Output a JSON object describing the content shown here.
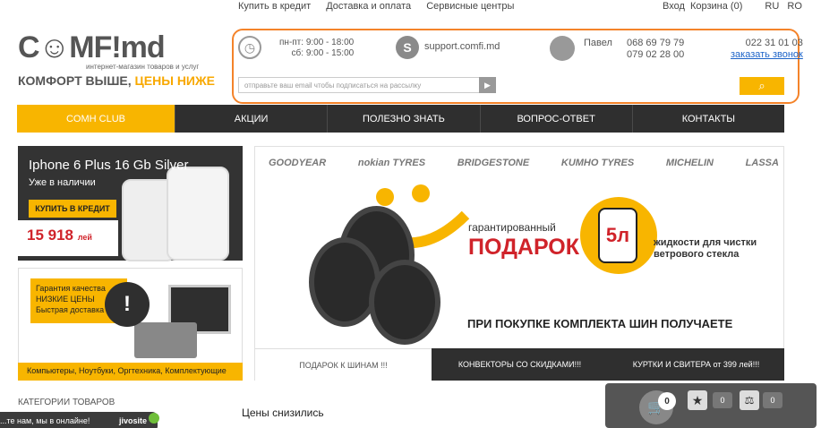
{
  "top_links": {
    "credit": "Купить в кредит",
    "delivery": "Доставка и оплата",
    "service": "Сервисные центры"
  },
  "top_right": {
    "login": "Вход",
    "cart": "Корзина (0)",
    "lang_ru": "RU",
    "lang_ro": "RO"
  },
  "logo": {
    "text": "C☺MF!md",
    "subtitle": "интернет-магазин товаров и услуг",
    "slogan_a": "КОМФОРТ ВЫШЕ,",
    "slogan_b": "ЦЕНЫ НИЖЕ"
  },
  "hours": {
    "weekdays": "пн-пт: 9:00 - 18:00",
    "saturday": "сб: 9:00 - 15:00"
  },
  "skype": {
    "label": "support.comfi.md"
  },
  "contact": {
    "name": "Павел",
    "phone1": "068 69 79 79",
    "phone2": "079 02 28 00",
    "phone3": "022 31 01 03",
    "callback": "заказать звонок"
  },
  "subscribe": {
    "placeholder": "отправьте ваш email чтобы подписаться на рассылку"
  },
  "nav": [
    "COMH CLUB",
    "АКЦИИ",
    "ПОЛЕЗНО ЗНАТЬ",
    "ВОПРОС-ОТВЕТ",
    "КОНТАКТЫ"
  ],
  "banner1": {
    "title": "Iphone 6 Plus 16 Gb Silver",
    "subtitle": "Уже в наличии",
    "button": "КУПИТЬ В КРЕДИТ",
    "price": "15 918",
    "currency": "лей"
  },
  "banner2": {
    "line1": "Гарантия качества",
    "line2": "НИЗКИЕ ЦЕНЫ",
    "line3": "Быстрая доставка",
    "footer": "Компьютеры, Ноутбуки, Оргтехника, Комплектующие",
    "mark": "!"
  },
  "brands": [
    "GOODYEAR",
    "nokian TYRES",
    "BRIDGESTONE",
    "KUMHO TYRES",
    "MICHELIN",
    "LASSA"
  ],
  "main_banner": {
    "guaranteed": "гарантированный",
    "gift": "ПОДАРОК",
    "bottle": "5л",
    "liquid": "жидкости для чистки ветрового стекла",
    "promo": "ПРИ ПОКУПКЕ КОМПЛЕКТА ШИН ПОЛУЧАЕТЕ"
  },
  "main_tabs": [
    "ПОДАРОК К ШИНАМ !!!",
    "КОНВЕКТОРЫ СО СКИДКАМИ!!!",
    "КУРТКИ И СВИТЕРА от 399 лей!!!"
  ],
  "categories_label": "КАТЕГОРИИ ТОВАРОВ",
  "prices_dropped": "Цены снизились",
  "chat": {
    "text": "...те нам, мы в онлайне!",
    "brand": "jivosite"
  },
  "cartbar": {
    "cart_count": "0",
    "fav_count": "0",
    "compare_count": "0"
  },
  "colors": {
    "accent": "#f8b500",
    "nav": "#2f2f2f",
    "highlight": "#f4832a",
    "price": "#d0232a"
  }
}
